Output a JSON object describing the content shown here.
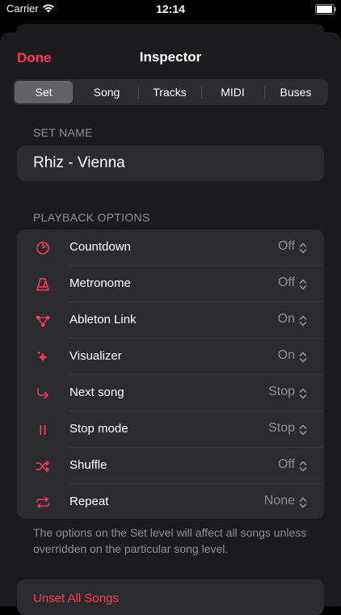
{
  "status_bar": {
    "carrier": "Carrier",
    "time": "12:14"
  },
  "nav": {
    "done_label": "Done",
    "title": "Inspector"
  },
  "tabs": [
    {
      "label": "Set",
      "selected": true
    },
    {
      "label": "Song",
      "selected": false
    },
    {
      "label": "Tracks",
      "selected": false
    },
    {
      "label": "MIDI",
      "selected": false
    },
    {
      "label": "Buses",
      "selected": false
    }
  ],
  "set_name": {
    "section": "SET NAME",
    "value": "Rhiz - Vienna"
  },
  "playback": {
    "section": "PLAYBACK OPTIONS",
    "rows": [
      {
        "icon": "timer-icon",
        "label": "Countdown",
        "value": "Off"
      },
      {
        "icon": "metronome-icon",
        "label": "Metronome",
        "value": "Off"
      },
      {
        "icon": "link-icon",
        "label": "Ableton Link",
        "value": "On"
      },
      {
        "icon": "sparkle-icon",
        "label": "Visualizer",
        "value": "On"
      },
      {
        "icon": "next-arrow-icon",
        "label": "Next song",
        "value": "Stop"
      },
      {
        "icon": "pause-icon",
        "label": "Stop mode",
        "value": "Stop"
      },
      {
        "icon": "shuffle-icon",
        "label": "Shuffle",
        "value": "Off"
      },
      {
        "icon": "repeat-icon",
        "label": "Repeat",
        "value": "None"
      }
    ],
    "footnote": "The options on the Set level will affect all songs unless overridden on the particular song level."
  },
  "actions": {
    "unset_all": "Unset All Songs"
  },
  "colors": {
    "accent": "#ff375f",
    "sheet": "#1c1c1e",
    "card": "#2c2c2e",
    "secondary_text": "#8e8e93"
  }
}
